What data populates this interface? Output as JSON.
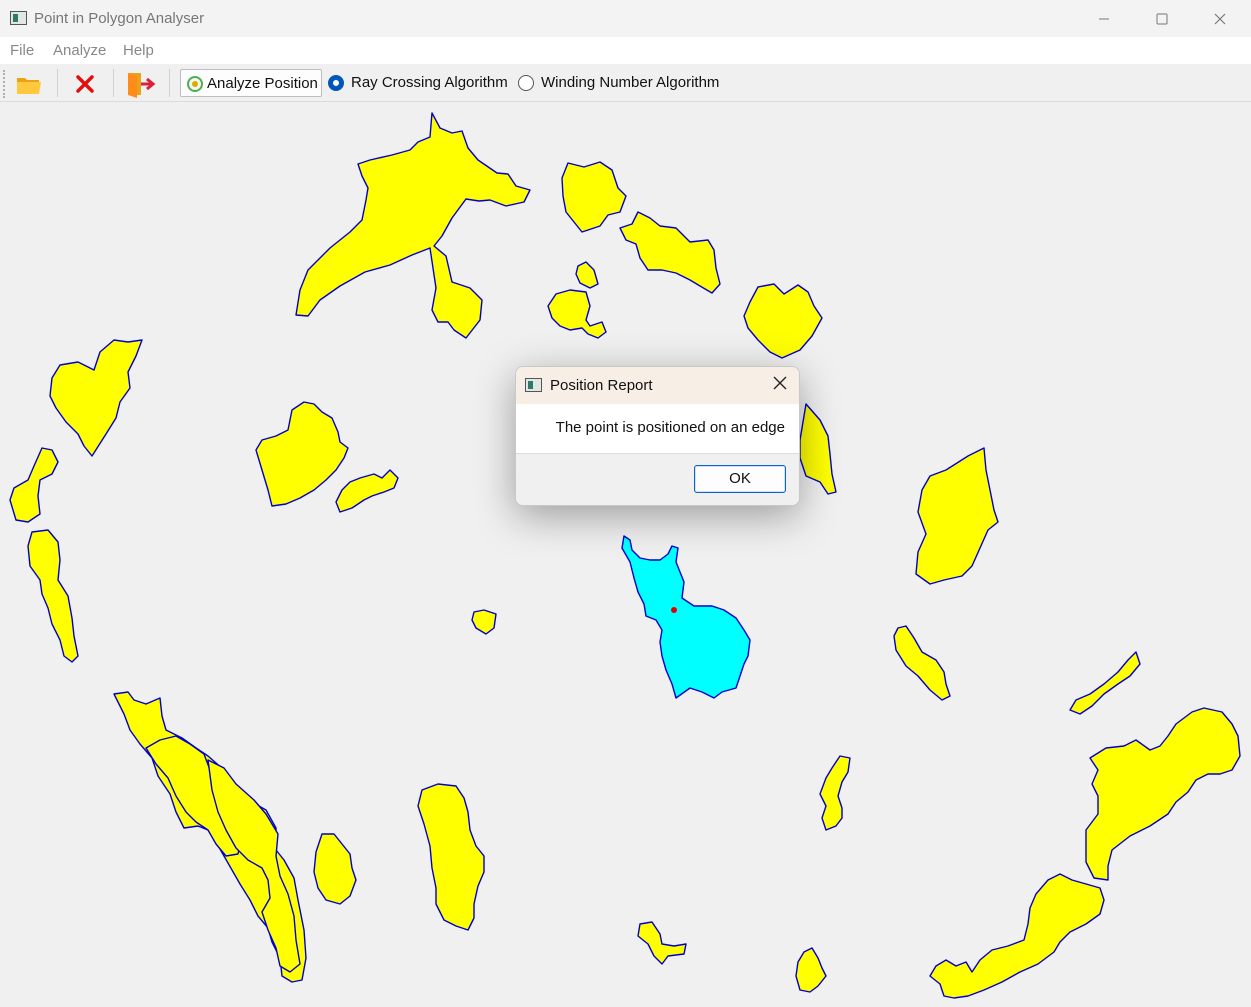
{
  "window": {
    "title": "Point in Polygon Analyser"
  },
  "menu": {
    "items": [
      "File",
      "Analyze",
      "Help"
    ]
  },
  "toolbar": {
    "open_icon": "folder-icon",
    "clear_icon": "red-x-icon",
    "exit_icon": "exit-door-icon",
    "analyze_label": "Analyze Position",
    "algorithms": [
      {
        "label": "Ray Crossing Algorithm",
        "checked": true
      },
      {
        "label": "Winding Number Algorithm",
        "checked": false
      }
    ]
  },
  "colors": {
    "polygon_fill": "#ffff00",
    "polygon_stroke": "#0000cc",
    "highlight_fill": "#00ffff",
    "point": "#e00000",
    "radio_accent": "#0057b7"
  },
  "dialog": {
    "title": "Position Report",
    "message": "The point is positioned on an edge",
    "ok_label": "OK"
  }
}
